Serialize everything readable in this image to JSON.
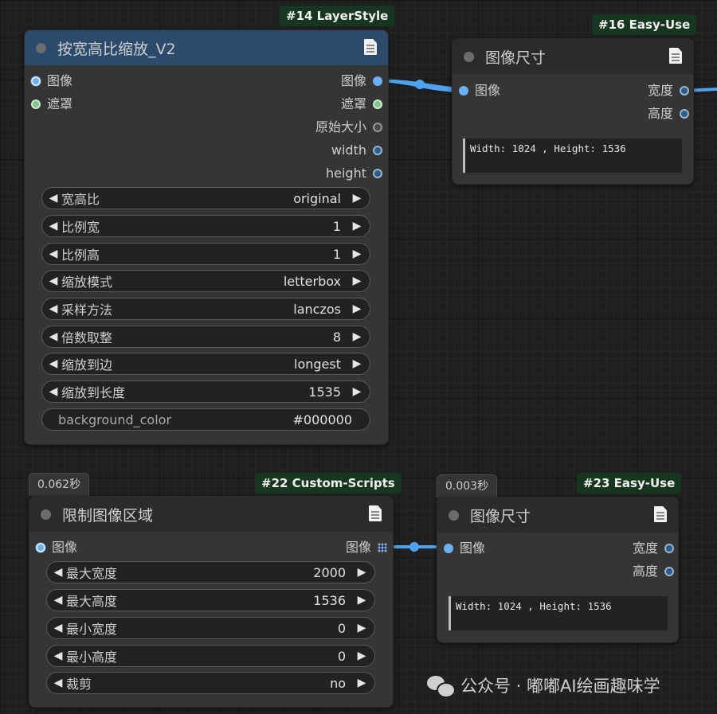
{
  "colors": {
    "image_wire": "#4fa3f0",
    "badge_bg": "#17361f",
    "title_blue": "#2c4a6b"
  },
  "nodes": {
    "n14": {
      "badge": "#14 LayerStyle",
      "title": "按宽高比缩放_V2",
      "inputs": [
        "图像",
        "遮罩"
      ],
      "outputs": [
        "图像",
        "遮罩",
        "原始大小",
        "width",
        "height"
      ],
      "widgets": [
        {
          "label": "宽高比",
          "value": "original"
        },
        {
          "label": "比例宽",
          "value": "1"
        },
        {
          "label": "比例高",
          "value": "1"
        },
        {
          "label": "缩放模式",
          "value": "letterbox"
        },
        {
          "label": "采样方法",
          "value": "lanczos"
        },
        {
          "label": "倍数取整",
          "value": "8"
        },
        {
          "label": "缩放到边",
          "value": "longest"
        },
        {
          "label": "缩放到长度",
          "value": "1535"
        }
      ],
      "text_widget": {
        "label": "background_color",
        "value": "#000000"
      }
    },
    "n16": {
      "badge": "#16 Easy-Use",
      "title": "图像尺寸",
      "inputs": [
        "图像"
      ],
      "outputs": [
        "宽度",
        "高度"
      ],
      "text": "Width: 1024 , Height: 1536"
    },
    "n22": {
      "badge": "#22 Custom-Scripts",
      "timer": "0.062秒",
      "title": "限制图像区域",
      "inputs": [
        "图像"
      ],
      "outputs": [
        "图像"
      ],
      "widgets": [
        {
          "label": "最大宽度",
          "value": "2000"
        },
        {
          "label": "最大高度",
          "value": "1536"
        },
        {
          "label": "最小宽度",
          "value": "0"
        },
        {
          "label": "最小高度",
          "value": "0"
        },
        {
          "label": "裁剪",
          "value": "no"
        }
      ]
    },
    "n23": {
      "badge": "#23 Easy-Use",
      "timer": "0.003秒",
      "title": "图像尺寸",
      "inputs": [
        "图像"
      ],
      "outputs": [
        "宽度",
        "高度"
      ],
      "text": "Width: 1024 , Height: 1536"
    }
  },
  "watermark": "公众号 · 嘟嘟AI绘画趣味学",
  "icons": {
    "node_doc": "document-icon",
    "collapse": "collapse-dot-icon",
    "arrow_left": "◀",
    "arrow_right": "▶",
    "list_output": "grid-list-icon",
    "watermark_logo": "wechat-icon"
  }
}
